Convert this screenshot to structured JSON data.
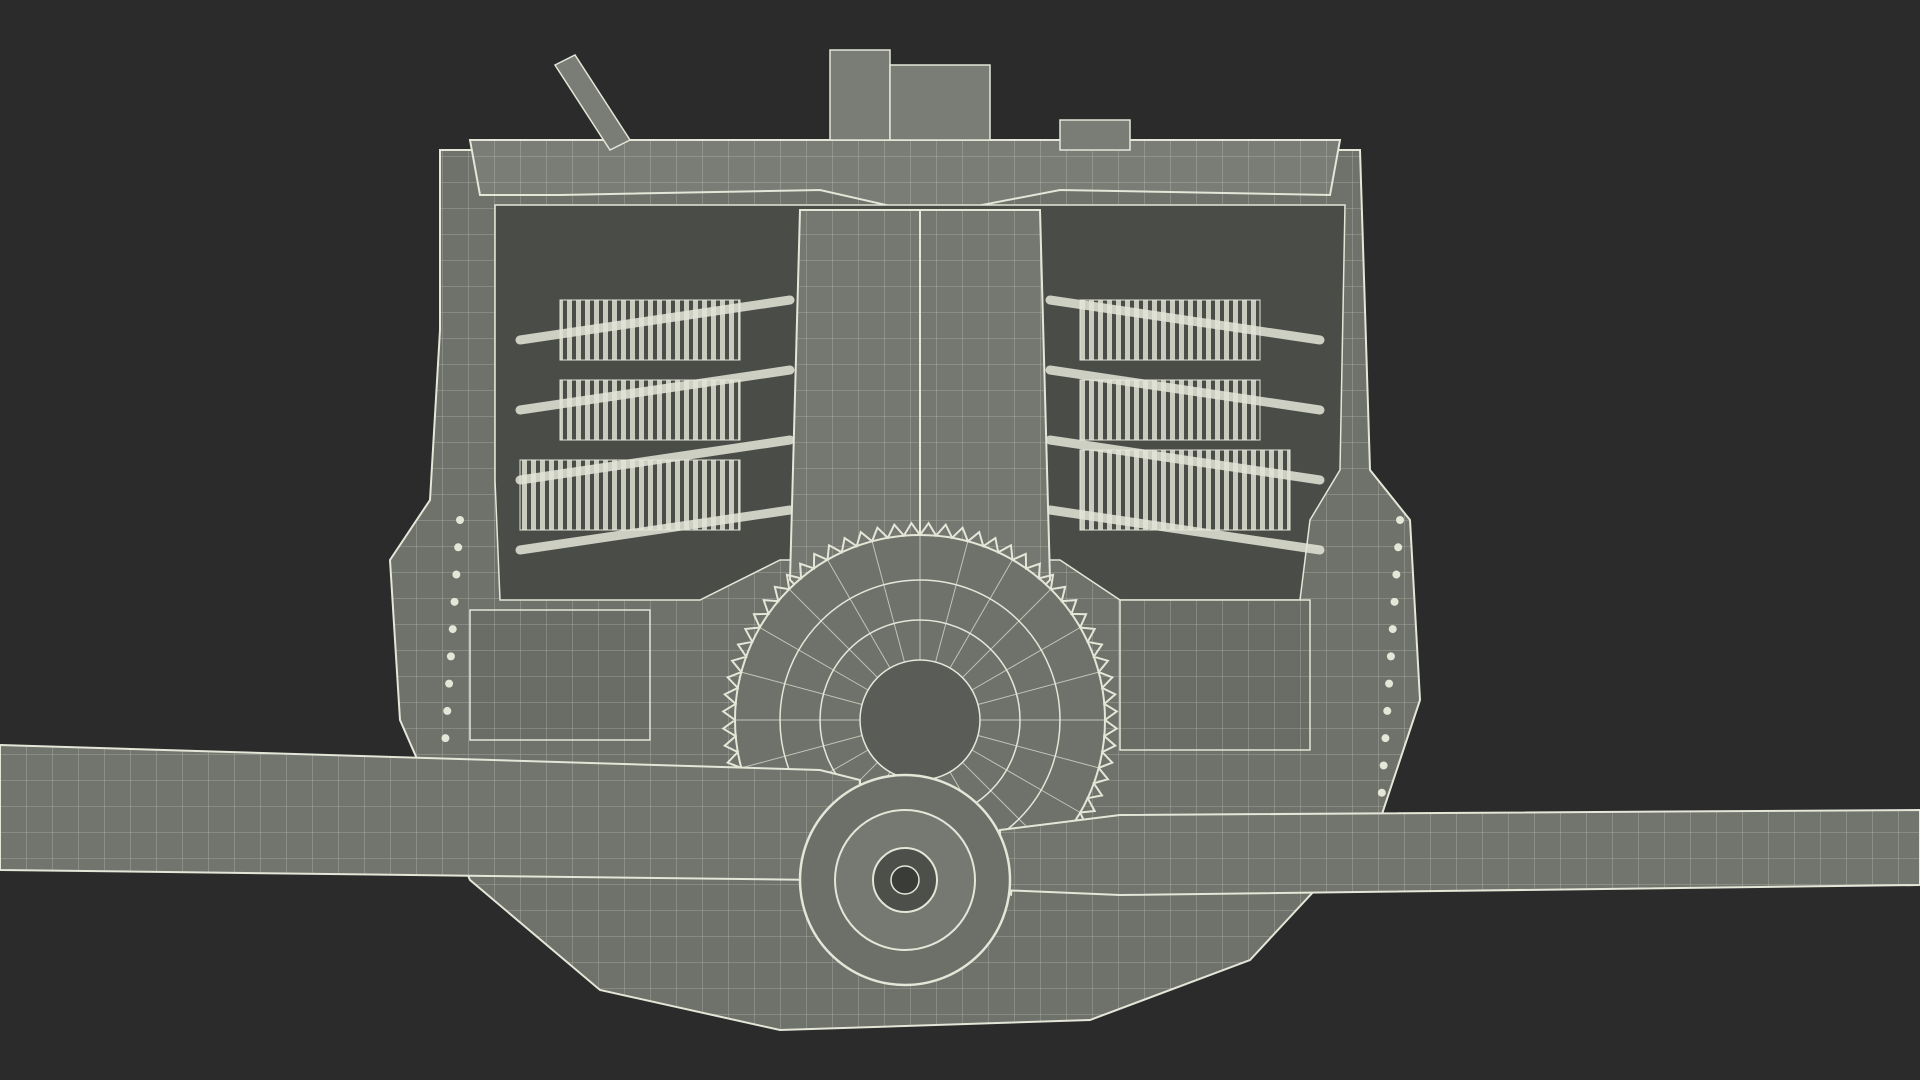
{
  "scene": {
    "background": "#2b2b2b",
    "mesh_fill": "#6f716b",
    "mesh_fill_dark": "#5a5c57",
    "wire_color": "#e4e6d8",
    "shadow_color": "#3b3d39"
  },
  "parts": {
    "propeller": {
      "blade_count": 2
    },
    "gear": {
      "tooth_count": 72
    },
    "cylinders": {
      "count_left": 3,
      "count_right": 3
    },
    "pushrods": {
      "count_per_side": 4
    },
    "rivets": {
      "count_per_side": 12
    }
  }
}
